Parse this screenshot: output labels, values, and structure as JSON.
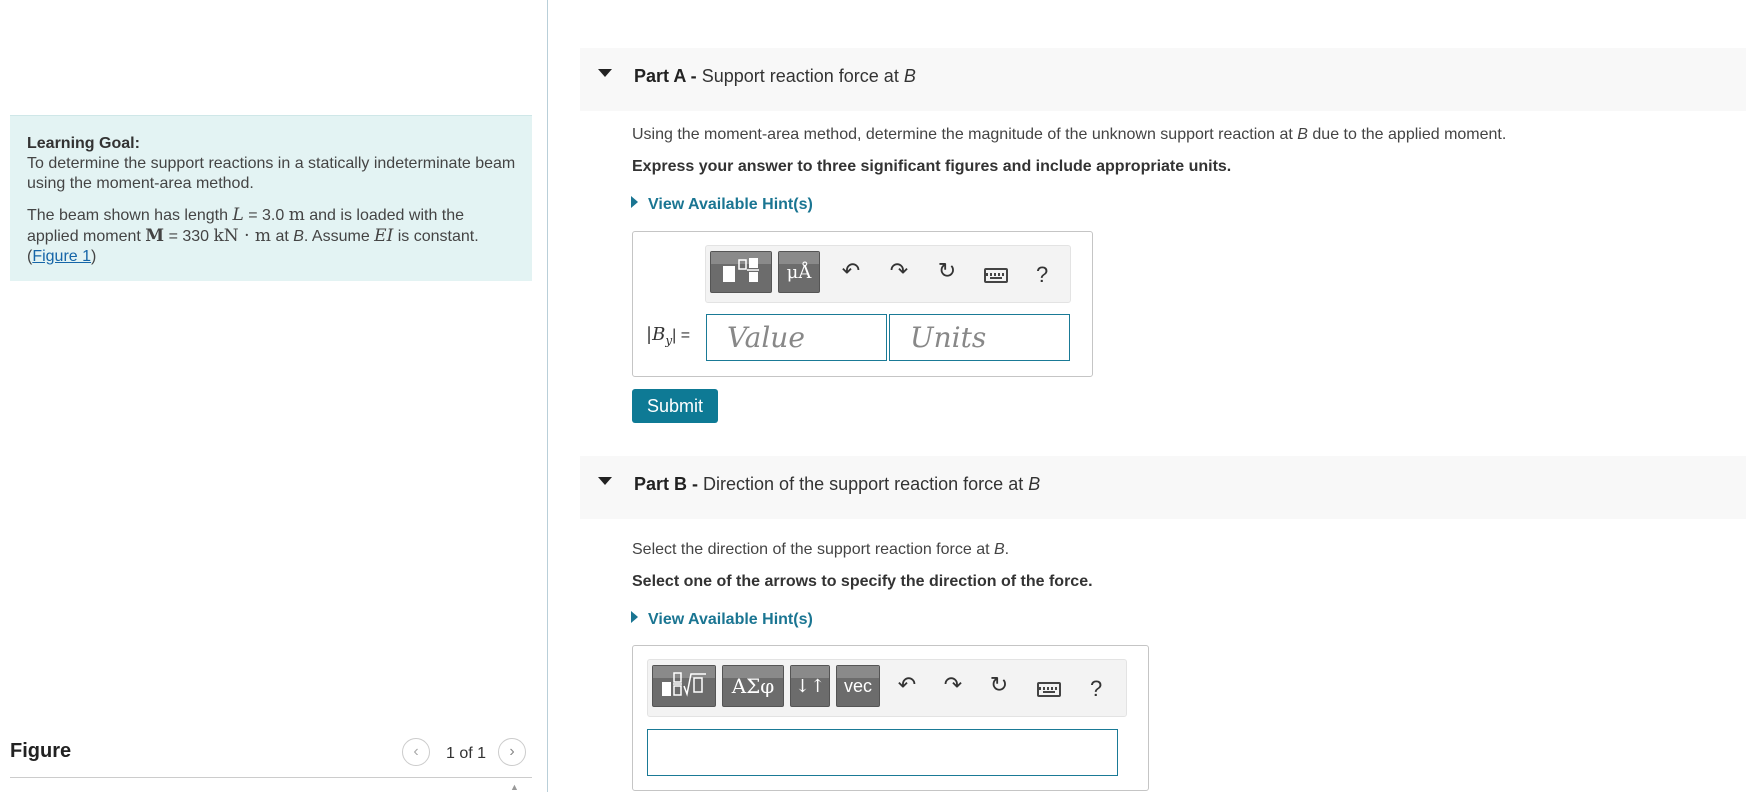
{
  "learning_goal": {
    "title": "Learning Goal:",
    "description": "To determine the support reactions in a statically indeterminate beam using the moment-area method.",
    "problem": {
      "part1": "The beam shown has length ",
      "L_symbol": "L",
      "eq1": " = 3.0 ",
      "L_unit": "m",
      "part2": " and is loaded with the applied moment ",
      "M_symbol": "M",
      "eq2": " = 330 ",
      "M_unit": "kN · m",
      "part3": " at ",
      "at_point": "B",
      "part4": ". Assume ",
      "EI_symbol": "EI",
      "part5": " is constant. (",
      "figure_link": "Figure 1",
      "part6": ")"
    }
  },
  "figure": {
    "label": "Figure",
    "prev_icon": "chevron-left-icon",
    "next_icon": "chevron-right-icon",
    "page_indicator": "1 of 1"
  },
  "part_a": {
    "prefix": "Part A -",
    "title": "Support reaction force at ",
    "title_point": "B",
    "question_before": "Using the moment-area method, determine the magnitude of the unknown support reaction at ",
    "question_point": "B",
    "question_after": " due to the applied moment.",
    "instruction": "Express your answer to three significant figures and include appropriate units.",
    "hint": "View Available Hint(s)",
    "toolbar": {
      "template_icon": "templates-icon",
      "units_label": "μÅ",
      "undo_icon": "undo-icon",
      "redo_icon": "redo-icon",
      "reset_icon": "reset-icon",
      "keyboard_icon": "keyboard-icon",
      "help_label": "?"
    },
    "answer_label_bar": "|",
    "answer_label_var": "B",
    "answer_label_sub": "y",
    "answer_label_eq": "| =",
    "value_placeholder": "Value",
    "units_placeholder": "Units",
    "submit": "Submit"
  },
  "part_b": {
    "prefix": "Part B -",
    "title": "Direction of the support reaction force at ",
    "title_point": "B",
    "question_before": "Select the direction of the support reaction force at ",
    "question_point": "B",
    "question_after": ".",
    "instruction": "Select one of the arrows to specify the direction of the force.",
    "hint": "View Available Hint(s)",
    "toolbar": {
      "template_icon": "templates-icon",
      "greek_label": "ΑΣφ",
      "arrows_label": "↓↑",
      "vec_label": "vec",
      "undo_icon": "undo-icon",
      "redo_icon": "redo-icon",
      "reset_icon": "reset-icon",
      "keyboard_icon": "keyboard-icon",
      "help_label": "?"
    }
  }
}
